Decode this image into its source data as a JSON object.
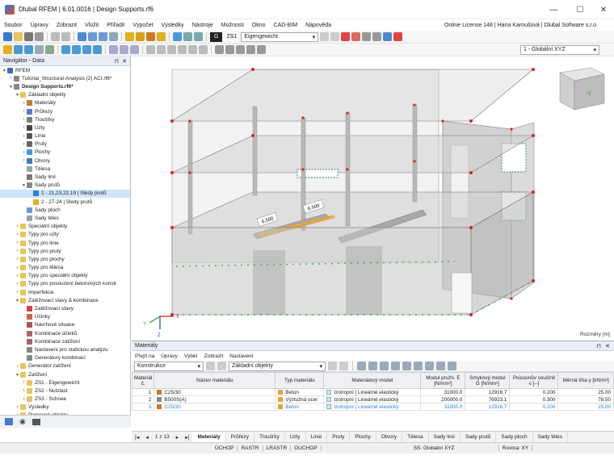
{
  "window": {
    "title": "Dlubal RFEM | 6.01.0016 | Design Supports.rf6"
  },
  "menu": {
    "items": [
      "Soubor",
      "Úpravy",
      "Zobrazit",
      "Vložit",
      "Přiřadit",
      "Výpočet",
      "Výsledky",
      "Nástroje",
      "Možnosti",
      "Okno",
      "CAD-BIM",
      "Nápověda"
    ],
    "license": "Online License 148 | Hana Karoušová | Dlubal Software s.r.o."
  },
  "toolbar": {
    "lc_badge": "G",
    "lc_code": "ZS1",
    "lc_name": "Eigengewicht",
    "coord_system": "1 - Globální XYZ"
  },
  "navigator": {
    "title": "Navigátor - Data",
    "items": [
      {
        "label": "RFEM",
        "lvl": 0,
        "exp": "▾",
        "color": "#3a6fb0"
      },
      {
        "label": "Tutorial_Structural-Analysis (2) ACI.rf6*",
        "lvl": 1,
        "exp": "›",
        "color": "#888"
      },
      {
        "label": "Design Supports.rf6*",
        "lvl": 1,
        "exp": "▾",
        "color": "#888",
        "bold": true
      },
      {
        "label": "Základní objekty",
        "lvl": 2,
        "exp": "▾",
        "color": "#e8c55a"
      },
      {
        "label": "Materiály",
        "lvl": 3,
        "exp": "›",
        "color": "#c77a2a"
      },
      {
        "label": "Průřezy",
        "lvl": 3,
        "exp": "›",
        "color": "#5577cc"
      },
      {
        "label": "Tloušťky",
        "lvl": 3,
        "exp": "›",
        "color": "#7a7a7a"
      },
      {
        "label": "Uzly",
        "lvl": 3,
        "exp": "›",
        "color": "#444"
      },
      {
        "label": "Linie",
        "lvl": 3,
        "exp": "›",
        "color": "#555"
      },
      {
        "label": "Pruty",
        "lvl": 3,
        "exp": "›",
        "color": "#666"
      },
      {
        "label": "Plochy",
        "lvl": 3,
        "exp": "›",
        "color": "#4a9ad8"
      },
      {
        "label": "Otvory",
        "lvl": 3,
        "exp": "›",
        "color": "#3a7ac8"
      },
      {
        "label": "Tělesa",
        "lvl": 3,
        "exp": "",
        "color": "#8aa"
      },
      {
        "label": "Sady linií",
        "lvl": 3,
        "exp": "",
        "color": "#777"
      },
      {
        "label": "Sady prutů",
        "lvl": 3,
        "exp": "▾",
        "color": "#888"
      },
      {
        "label": "1 - 21,23,22,19 | Sledy prutů",
        "lvl": 4,
        "exp": "",
        "color": "#2a7de1",
        "sel": true
      },
      {
        "label": "2 - 27-24 | Sledy prutů",
        "lvl": 4,
        "exp": "",
        "color": "#e0b020"
      },
      {
        "label": "Sady ploch",
        "lvl": 3,
        "exp": "",
        "color": "#6a9ad8"
      },
      {
        "label": "Sady těles",
        "lvl": 3,
        "exp": "",
        "color": "#8aa"
      },
      {
        "label": "Speciální objekty",
        "lvl": 2,
        "exp": "›",
        "color": "#e8c55a"
      },
      {
        "label": "Typy pro uzly",
        "lvl": 2,
        "exp": "›",
        "color": "#e8c55a"
      },
      {
        "label": "Typy pro linie",
        "lvl": 2,
        "exp": "›",
        "color": "#e8c55a"
      },
      {
        "label": "Typy pro pruty",
        "lvl": 2,
        "exp": "›",
        "color": "#e8c55a"
      },
      {
        "label": "Typy pro plochy",
        "lvl": 2,
        "exp": "›",
        "color": "#e8c55a"
      },
      {
        "label": "Typy pro tělesa",
        "lvl": 2,
        "exp": "›",
        "color": "#e8c55a"
      },
      {
        "label": "Typy pro speciální objekty",
        "lvl": 2,
        "exp": "›",
        "color": "#e8c55a"
      },
      {
        "label": "Typy pro posouzení betonových konstr",
        "lvl": 2,
        "exp": "›",
        "color": "#e8c55a"
      },
      {
        "label": "Imperfekce",
        "lvl": 2,
        "exp": "›",
        "color": "#e8c55a"
      },
      {
        "label": "Zatěžovací stavy & kombinace",
        "lvl": 2,
        "exp": "▾",
        "color": "#e8c55a"
      },
      {
        "label": "Zatěžovací stavy",
        "lvl": 3,
        "exp": "",
        "color": "#c44"
      },
      {
        "label": "Účinky",
        "lvl": 3,
        "exp": "",
        "color": "#c64"
      },
      {
        "label": "Návrhové situace",
        "lvl": 3,
        "exp": "",
        "color": "#a55"
      },
      {
        "label": "Kombinace účinků",
        "lvl": 3,
        "exp": "",
        "color": "#a66"
      },
      {
        "label": "Kombinace zatížení",
        "lvl": 3,
        "exp": "",
        "color": "#a66"
      },
      {
        "label": "Nastavení pro statickou analýzu",
        "lvl": 3,
        "exp": "",
        "color": "#888"
      },
      {
        "label": "Generátory kombinací",
        "lvl": 3,
        "exp": "",
        "color": "#888"
      },
      {
        "label": "Generátor zatížení",
        "lvl": 2,
        "exp": "›",
        "color": "#e8c55a"
      },
      {
        "label": "Zatížení",
        "lvl": 2,
        "exp": "▾",
        "color": "#e8c55a"
      },
      {
        "label": "ZS1 - Eigengewicht",
        "lvl": 3,
        "exp": "›",
        "color": "#e8c55a"
      },
      {
        "label": "ZS2 - Nutzlast",
        "lvl": 3,
        "exp": "›",
        "color": "#e8c55a"
      },
      {
        "label": "ZS3 - Schnee",
        "lvl": 3,
        "exp": "›",
        "color": "#e8c55a"
      },
      {
        "label": "Výsledky",
        "lvl": 2,
        "exp": "›",
        "color": "#e8c55a"
      },
      {
        "label": "Pomocné objekty",
        "lvl": 2,
        "exp": "›",
        "color": "#e8c55a"
      }
    ]
  },
  "view": {
    "dim1": "6.500",
    "dim2": "6.500",
    "axis_x": "X",
    "axis_y": "Y",
    "axis_z": "Z",
    "scale": "Rozměry [m]",
    "cube": "-Y"
  },
  "materials": {
    "title": "Materiály",
    "menu": [
      "Přejít na",
      "Úpravy",
      "Výběr",
      "Zobrazit",
      "Nastavení"
    ],
    "filter1": "Konstrukce",
    "filter2": "Základní objekty",
    "headers": [
      "Materiál č.",
      "Název materiálu",
      "Typ materiálu",
      "Materiálový model",
      "Modul pružn. E [N/mm²]",
      "Smykový modul G [N/mm²]",
      "Poissonův součinit ν [--]",
      "Měrná tíha γ [kN/m³]"
    ],
    "rows": [
      {
        "no": "1",
        "name": "C25/30",
        "type": "Beton",
        "model": "Izotropní | Lineárně elastický",
        "e": "31000.0",
        "g": "12916.7",
        "nu": "0.200",
        "w": "25.00",
        "c1": "#c77a2a",
        "c2": "#e8a33a"
      },
      {
        "no": "2",
        "name": "B500S(A)",
        "type": "Výztužná ocel",
        "model": "Izotropní | Lineárně elastický",
        "e": "200000.0",
        "g": "76923.1",
        "nu": "0.300",
        "w": "78.50",
        "c1": "#888888",
        "c2": "#e8a33a"
      },
      {
        "no": "3",
        "name": "C25/30",
        "type": "Beton",
        "model": "Izotropní | Lineárně elastický",
        "e": "31000.0",
        "g": "12916.7",
        "nu": "0.200",
        "w": "25.00",
        "c1": "#c77a2a",
        "c2": "#e8a33a"
      }
    ],
    "page": "1 z 13"
  },
  "tabs": [
    "Materiály",
    "Průřezy",
    "Tloušťky",
    "Uzly",
    "Linie",
    "Pruty",
    "Plochy",
    "Otvory",
    "Tělesa",
    "Sady linií",
    "Sady prutů",
    "Sady ploch",
    "Sady těles"
  ],
  "status": {
    "snap": [
      "ÚCHOP",
      "RASTR",
      "LRASTR",
      "OUCHOP"
    ],
    "cs": "SS: Globální XYZ",
    "plane": "Rovina: XY"
  }
}
